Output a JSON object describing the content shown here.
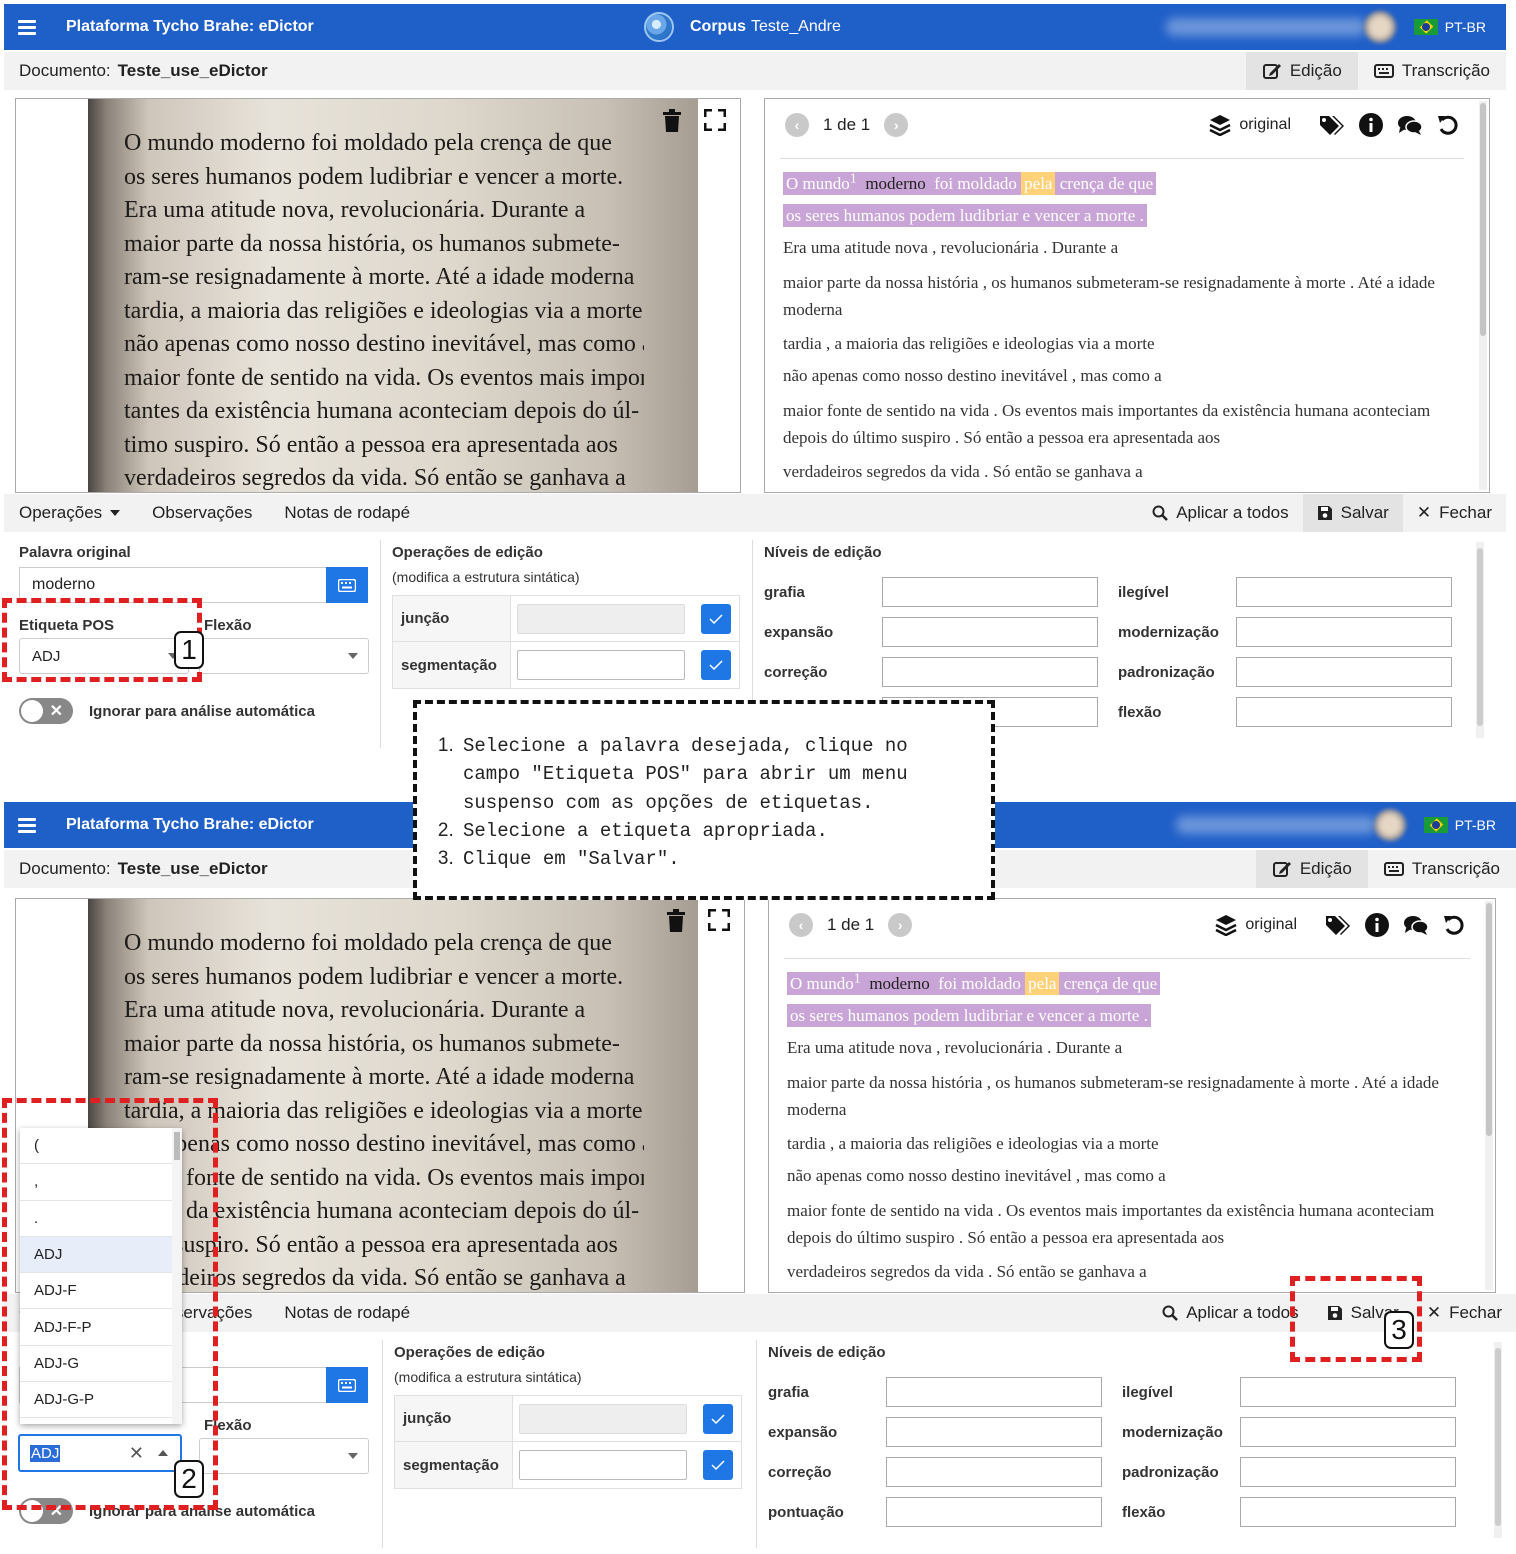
{
  "app": {
    "title": "Plataforma Tycho Brahe: eDictor",
    "corpus_label": "Corpus",
    "corpus_name": "Teste_Andre",
    "lang": "PT-BR"
  },
  "document": {
    "label": "Documento:",
    "name": "Teste_use_eDictor",
    "tab_edit": "Edição",
    "tab_transcription": "Transcrição"
  },
  "image_text": [
    "O mundo moderno foi moldado pela crença de que",
    "os seres humanos podem ludibriar e vencer a morte.",
    "Era uma atitude nova, revolucionária. Durante a",
    "maior parte da nossa história, os humanos submete-",
    "ram-se resignadamente à morte. Até a idade moderna",
    "tardia, a maioria das religiões e ideologias via a morte",
    "não apenas como nosso destino inevitável, mas como a",
    "maior fonte de sentido na vida. Os eventos mais impor-",
    "tantes da existência humana aconteciam depois do úl-",
    "timo suspiro. Só então a pessoa era apresentada aos",
    "verdadeiros segredos da vida. Só então se ganhava a"
  ],
  "transcription": {
    "pager": "1 de 1",
    "view_label": "original",
    "line1": {
      "w1": "O mundo",
      "sup": "1",
      "w2": "moderno",
      "w3": "foi moldado",
      "w4": "pela",
      "w5": "crença de que"
    },
    "line2": "os seres humanos podem ludibriar e vencer a morte .",
    "lines": [
      "Era uma atitude nova , revolucionária . Durante a",
      "maior parte da nossa história , os humanos submeteram-se resignadamente à morte . Até a idade moderna",
      "tardia , a maioria das religiões e ideologias via a morte",
      "não apenas como nosso destino inevitável , mas como a",
      "maior fonte de sentido na vida . Os eventos mais importantes da existência humana aconteciam depois do último suspiro . Só então a pessoa era apresentada aos",
      "verdadeiros segredos da vida . Só então se ganhava a"
    ]
  },
  "opbar": {
    "operations": "Operações",
    "notes": "Observações",
    "footnotes": "Notas de rodapé",
    "apply_all": "Aplicar a todos",
    "save": "Salvar",
    "close": "Fechar"
  },
  "form": {
    "original_word_label": "Palavra original",
    "original_word": "moderno",
    "pos_label": "Etiqueta POS",
    "pos_value": "ADJ",
    "inflection_label": "Flexão",
    "ignore_label": "Ignorar para análise automática",
    "ops_title": "Operações de edição",
    "ops_sub": "(modifica a estrutura sintática)",
    "join": "junção",
    "segment": "segmentação",
    "levels_title": "Níveis de edição",
    "levels": {
      "grafia": "grafia",
      "ilegivel": "ilegível",
      "expansao": "expansão",
      "modernizacao": "modernização",
      "correcao": "correção",
      "padronizacao": "padronização",
      "pontuacao": "pontuação",
      "flexao": "flexão"
    }
  },
  "dropdown_options": [
    "(",
    ",",
    ".",
    "ADJ",
    "ADJ-F",
    "ADJ-F-P",
    "ADJ-G",
    "ADJ-G-P"
  ],
  "badges": {
    "one": "1",
    "two": "2",
    "three": "3"
  },
  "instructions": [
    "Selecione a palavra desejada, clique no campo \"Etiqueta POS\" para abrir um menu suspenso com as opções de etiquetas.",
    "Selecione a etiqueta apropriada.",
    "Clique em \"Salvar\"."
  ],
  "colors": {
    "appbar": "#1f5fc8",
    "highlight": "#c8a5d6",
    "selected_word": "#ffd27a",
    "annotation": "#e02020",
    "button_blue": "#1f77e6"
  }
}
